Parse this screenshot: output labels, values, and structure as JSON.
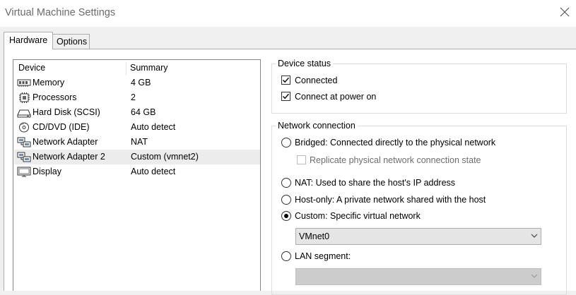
{
  "window": {
    "title": "Virtual Machine Settings"
  },
  "tabs": [
    {
      "label": "Hardware"
    },
    {
      "label": "Options"
    }
  ],
  "device_list": {
    "headers": {
      "device": "Device",
      "summary": "Summary"
    },
    "rows": [
      {
        "name": "Memory",
        "summary": "4 GB",
        "icon": "memory-icon"
      },
      {
        "name": "Processors",
        "summary": "2",
        "icon": "processor-icon"
      },
      {
        "name": "Hard Disk (SCSI)",
        "summary": "64 GB",
        "icon": "hard-disk-icon"
      },
      {
        "name": "CD/DVD (IDE)",
        "summary": "Auto detect",
        "icon": "cd-dvd-icon"
      },
      {
        "name": "Network Adapter",
        "summary": "NAT",
        "icon": "network-adapter-icon"
      },
      {
        "name": "Network Adapter 2",
        "summary": "Custom (vmnet2)",
        "icon": "network-adapter-icon",
        "selected": true
      },
      {
        "name": "Display",
        "summary": "Auto detect",
        "icon": "display-icon"
      }
    ]
  },
  "device_status": {
    "title": "Device status",
    "connected": {
      "label": "Connected",
      "checked": true
    },
    "connect_at_power_on": {
      "label": "Connect at power on",
      "checked": true
    }
  },
  "network_connection": {
    "title": "Network connection",
    "bridged": {
      "label": "Bridged: Connected directly to the physical network",
      "selected": false
    },
    "replicate": {
      "label": "Replicate physical network connection state",
      "checked": false,
      "enabled": false
    },
    "nat": {
      "label": "NAT: Used to share the host's IP address",
      "selected": false
    },
    "host_only": {
      "label": "Host-only: A private network shared with the host",
      "selected": false
    },
    "custom": {
      "label": "Custom: Specific virtual network",
      "selected": true
    },
    "custom_network_value": "VMnet0",
    "lan_segment": {
      "label": "LAN segment:",
      "selected": false
    },
    "lan_segment_value": ""
  },
  "colors": {
    "window_bg": "#f0f0f0",
    "panel_bg": "#ffffff",
    "selected_row": "#ececec",
    "title_text": "#6b6b6b"
  }
}
